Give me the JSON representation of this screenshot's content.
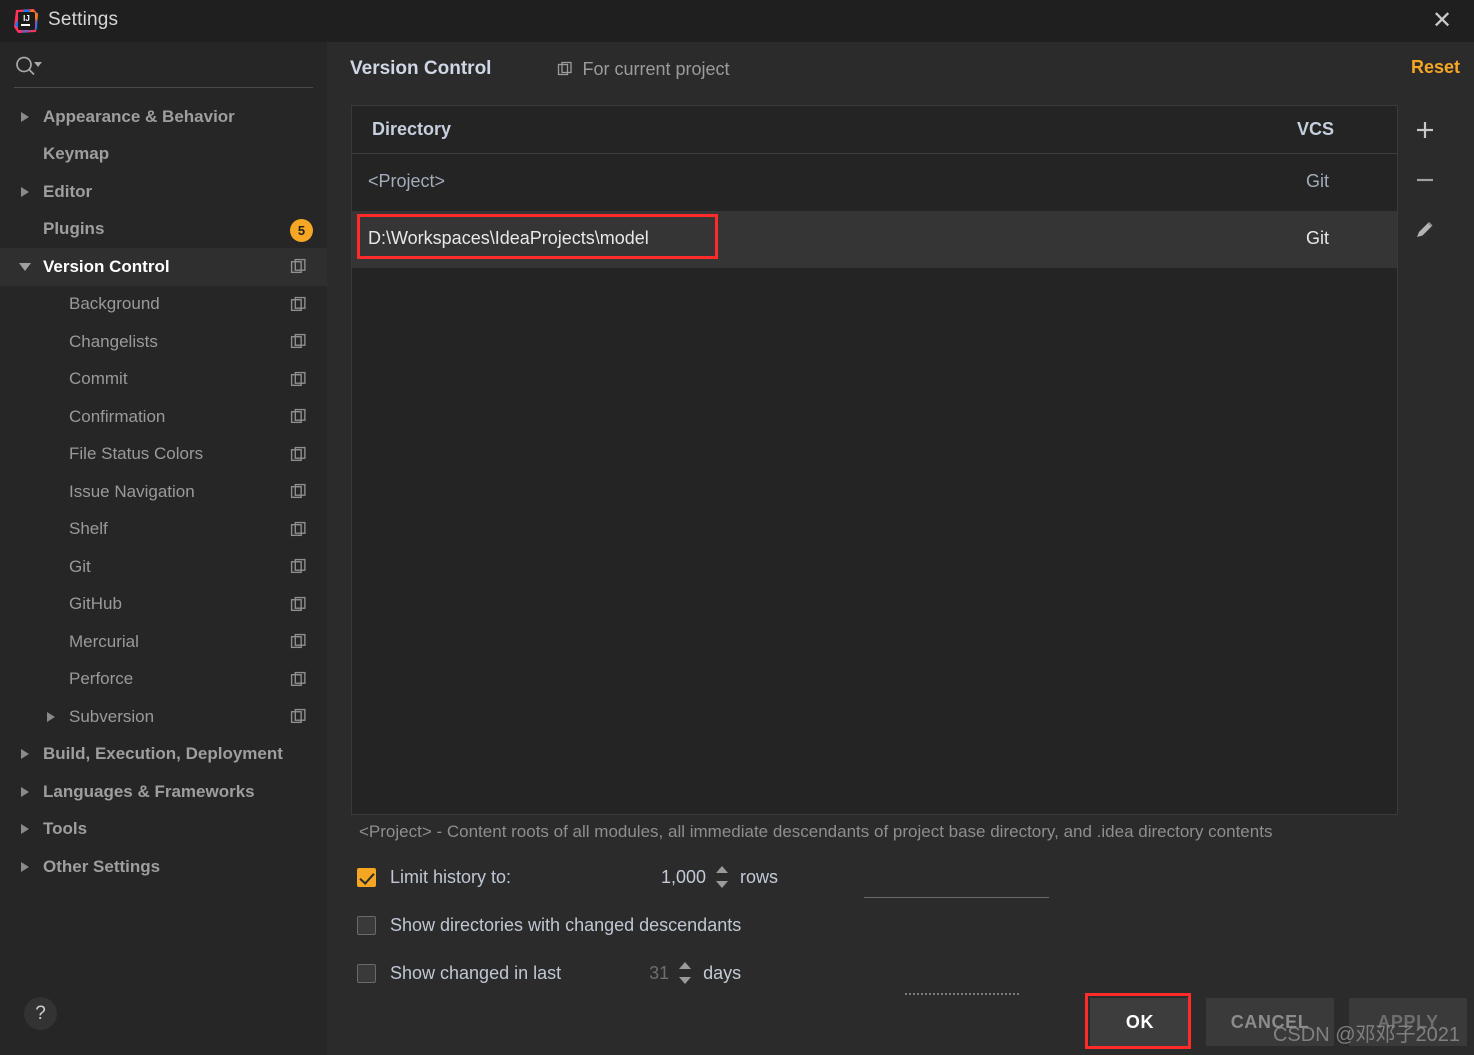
{
  "window": {
    "title": "Settings",
    "logo_icon": "intellij-idea-logo",
    "close_icon": "close-icon"
  },
  "sidebar": {
    "search": {
      "placeholder": "",
      "value": "",
      "icon": "search-icon",
      "dropdown_icon": "chevron-down-icon"
    },
    "items": [
      {
        "label": "Appearance & Behavior",
        "level": 0,
        "twisty": "right",
        "bold": true,
        "copy_icon": false,
        "badge": null,
        "selected": false
      },
      {
        "label": "Keymap",
        "level": 0,
        "twisty": "none",
        "bold": true,
        "copy_icon": false,
        "badge": null,
        "selected": false
      },
      {
        "label": "Editor",
        "level": 0,
        "twisty": "right",
        "bold": true,
        "copy_icon": false,
        "badge": null,
        "selected": false
      },
      {
        "label": "Plugins",
        "level": 0,
        "twisty": "none",
        "bold": true,
        "copy_icon": false,
        "badge": "5",
        "selected": false
      },
      {
        "label": "Version Control",
        "level": 0,
        "twisty": "down",
        "bold": true,
        "copy_icon": true,
        "badge": null,
        "selected": true
      },
      {
        "label": "Background",
        "level": 1,
        "twisty": "none",
        "bold": false,
        "copy_icon": true,
        "badge": null,
        "selected": false
      },
      {
        "label": "Changelists",
        "level": 1,
        "twisty": "none",
        "bold": false,
        "copy_icon": true,
        "badge": null,
        "selected": false
      },
      {
        "label": "Commit",
        "level": 1,
        "twisty": "none",
        "bold": false,
        "copy_icon": true,
        "badge": null,
        "selected": false
      },
      {
        "label": "Confirmation",
        "level": 1,
        "twisty": "none",
        "bold": false,
        "copy_icon": true,
        "badge": null,
        "selected": false
      },
      {
        "label": "File Status Colors",
        "level": 1,
        "twisty": "none",
        "bold": false,
        "copy_icon": true,
        "badge": null,
        "selected": false
      },
      {
        "label": "Issue Navigation",
        "level": 1,
        "twisty": "none",
        "bold": false,
        "copy_icon": true,
        "badge": null,
        "selected": false
      },
      {
        "label": "Shelf",
        "level": 1,
        "twisty": "none",
        "bold": false,
        "copy_icon": true,
        "badge": null,
        "selected": false
      },
      {
        "label": "Git",
        "level": 1,
        "twisty": "none",
        "bold": false,
        "copy_icon": true,
        "badge": null,
        "selected": false
      },
      {
        "label": "GitHub",
        "level": 1,
        "twisty": "none",
        "bold": false,
        "copy_icon": true,
        "badge": null,
        "selected": false
      },
      {
        "label": "Mercurial",
        "level": 1,
        "twisty": "none",
        "bold": false,
        "copy_icon": true,
        "badge": null,
        "selected": false
      },
      {
        "label": "Perforce",
        "level": 1,
        "twisty": "none",
        "bold": false,
        "copy_icon": true,
        "badge": null,
        "selected": false
      },
      {
        "label": "Subversion",
        "level": 1,
        "twisty": "right",
        "bold": false,
        "copy_icon": true,
        "badge": null,
        "selected": false
      },
      {
        "label": "Build, Execution, Deployment",
        "level": 0,
        "twisty": "right",
        "bold": true,
        "copy_icon": false,
        "badge": null,
        "selected": false
      },
      {
        "label": "Languages & Frameworks",
        "level": 0,
        "twisty": "right",
        "bold": true,
        "copy_icon": false,
        "badge": null,
        "selected": false
      },
      {
        "label": "Tools",
        "level": 0,
        "twisty": "right",
        "bold": true,
        "copy_icon": false,
        "badge": null,
        "selected": false
      },
      {
        "label": "Other Settings",
        "level": 0,
        "twisty": "right",
        "bold": true,
        "copy_icon": false,
        "badge": null,
        "selected": false
      }
    ],
    "help_label": "?"
  },
  "main": {
    "page_title": "Version Control",
    "for_current_project": "For current project",
    "for_current_project_icon": "copy-icon",
    "reset_label": "Reset",
    "table": {
      "columns": [
        "Directory",
        "VCS"
      ],
      "rows": [
        {
          "directory": "<Project>",
          "vcs": "Git",
          "selected": false,
          "highlighted": false
        },
        {
          "directory": "D:\\Workspaces\\IdeaProjects\\model",
          "vcs": "Git",
          "selected": true,
          "highlighted": true
        }
      ],
      "toolbar": [
        {
          "name": "add-directory-button",
          "icon": "plus-icon"
        },
        {
          "name": "remove-directory-button",
          "icon": "minus-icon"
        },
        {
          "name": "edit-directory-button",
          "icon": "pencil-icon"
        }
      ]
    },
    "hint": "<Project> - Content roots of all modules, all immediate descendants of project base directory, and .idea directory contents",
    "options": {
      "limit_history": {
        "label": "Limit history to:",
        "checked": true,
        "value": "1,000",
        "unit": "rows"
      },
      "show_changed_descendants": {
        "label": "Show directories with changed descendants",
        "checked": false
      },
      "show_changed_in_last": {
        "label": "Show changed in last",
        "checked": false,
        "value": "31",
        "unit": "days"
      }
    }
  },
  "footer": {
    "ok_label": "OK",
    "cancel_label": "CANCEL",
    "apply_label": "APPLY"
  },
  "watermark": "CSDN @邓邓子2021",
  "colors": {
    "accent_orange": "#f5a623",
    "highlight_red": "#ff2b2b",
    "window_bg": "#2b2b2b",
    "sidebar_bg": "#262626",
    "titlebar_bg": "#1f1f1f"
  }
}
